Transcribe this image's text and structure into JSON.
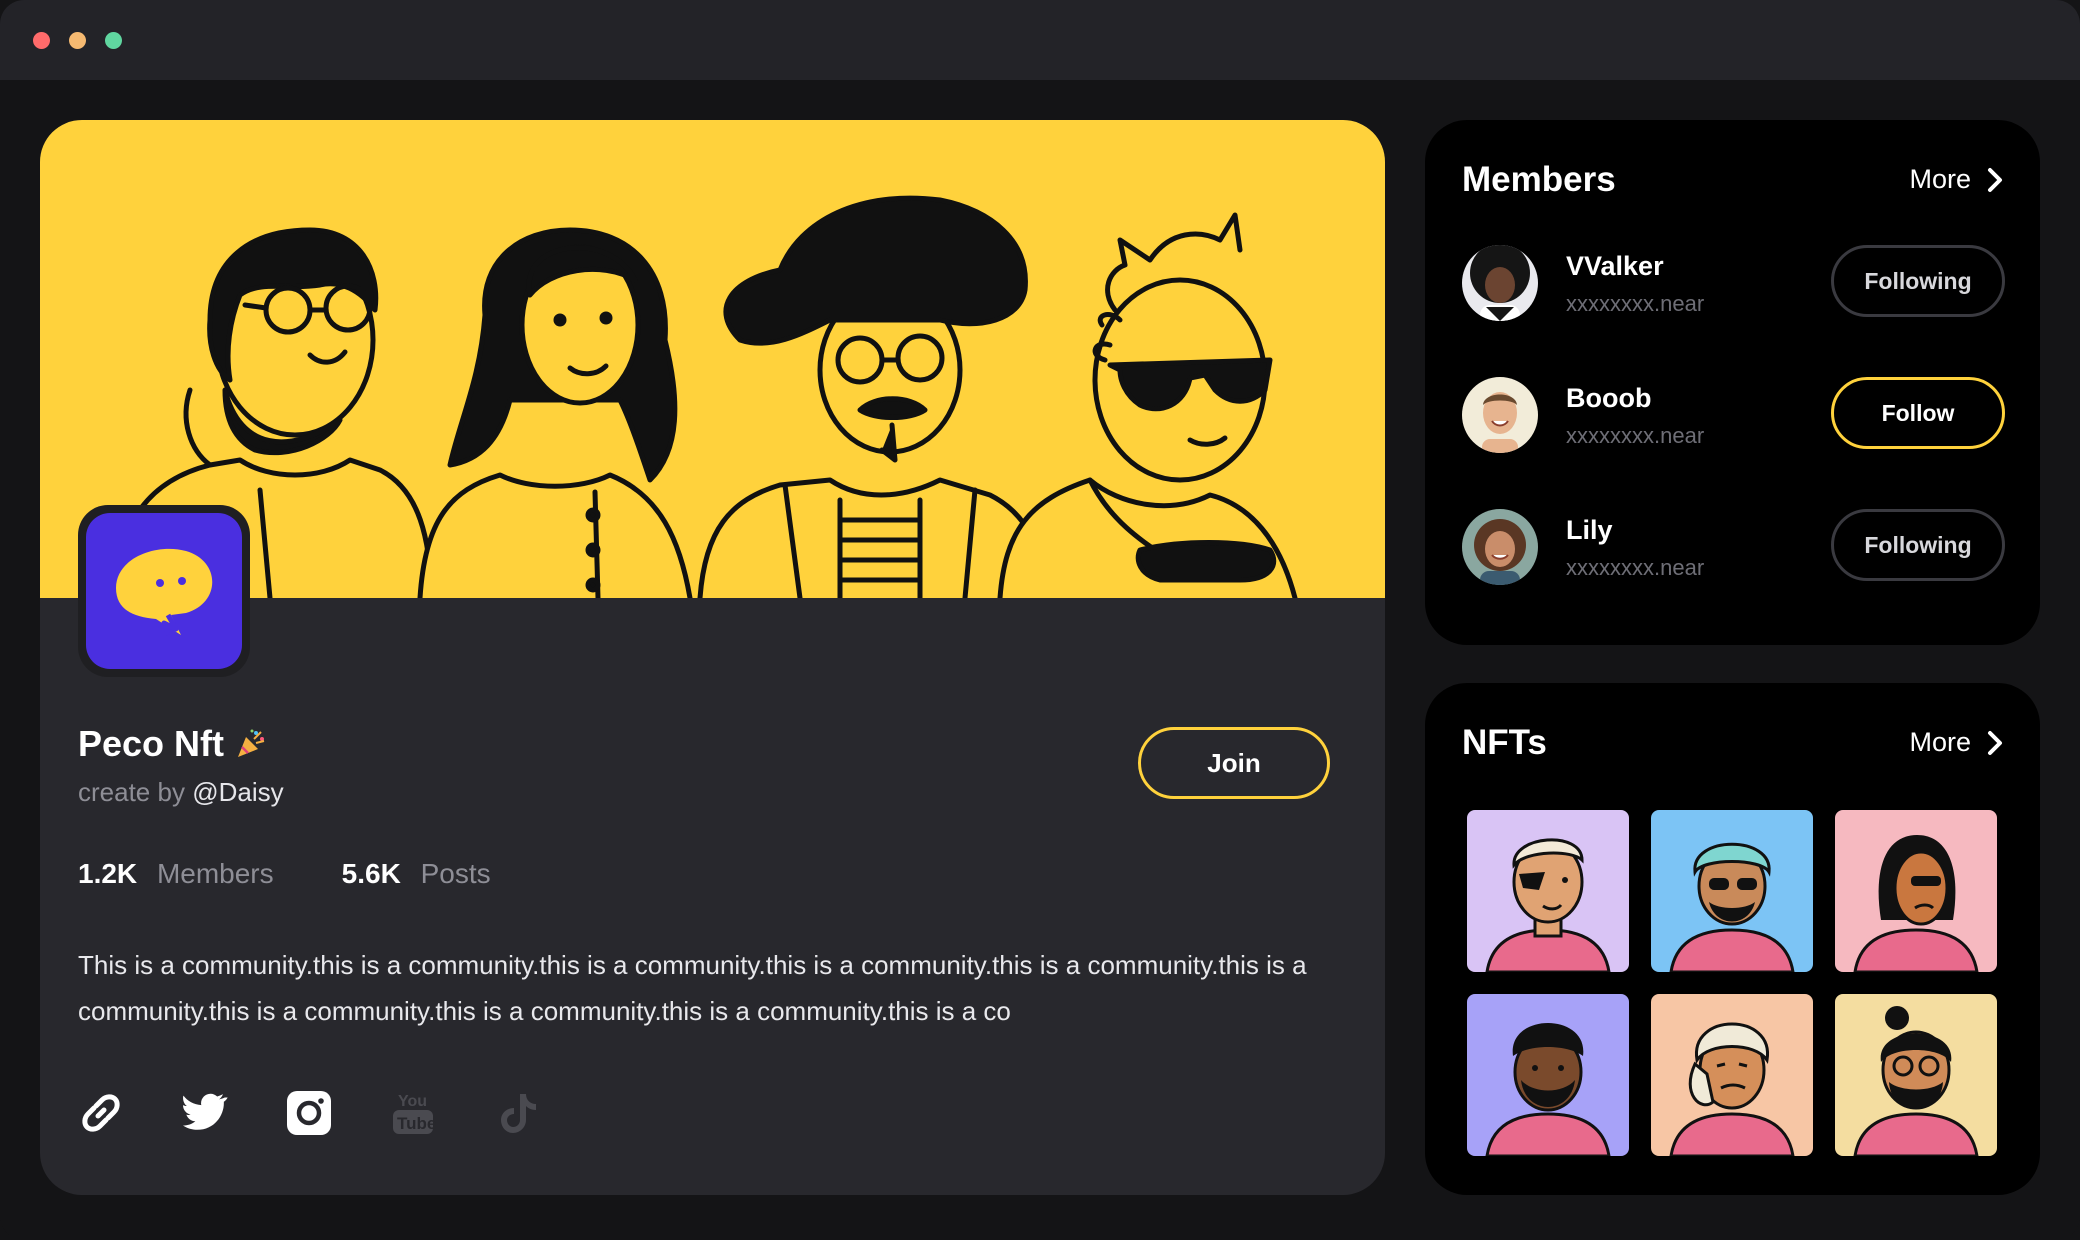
{
  "window": {
    "controls": [
      "close",
      "minimize",
      "maximize"
    ],
    "colors": {
      "close": "#ff6b6b",
      "minimize": "#f5b971",
      "maximize": "#60d6a0"
    }
  },
  "community": {
    "name": "Peco Nft",
    "emoji_icon": "party-popper-icon",
    "creator_prefix": "create by",
    "creator_handle": "@Daisy",
    "join_label": "Join",
    "stats": [
      {
        "value": "1.2K",
        "label": "Members"
      },
      {
        "value": "5.6K",
        "label": "Posts"
      }
    ],
    "description": "This is a community.this is a community.this is a community.this is a community.this is a community.this is a community.this is a community.this is a community.this is a community.this is a co",
    "socials": [
      "link-icon",
      "twitter-icon",
      "instagram-icon",
      "youtube-icon",
      "tiktok-icon"
    ],
    "accent_color": "#ffd23c",
    "logo_color": "#4a2fe0"
  },
  "members": {
    "title": "Members",
    "more_label": "More",
    "items": [
      {
        "name": "VValker",
        "sub": "xxxxxxxx.near",
        "action": "Following",
        "state": "following"
      },
      {
        "name": "Booob",
        "sub": "xxxxxxxx.near",
        "action": "Follow",
        "state": "follow"
      },
      {
        "name": "Lily",
        "sub": "xxxxxxxx.near",
        "action": "Following",
        "state": "following"
      }
    ]
  },
  "nfts": {
    "title": "NFTs",
    "more_label": "More",
    "items": [
      {
        "bg": "#d9c4f5"
      },
      {
        "bg": "#7cc4f5"
      },
      {
        "bg": "#f6b9c0"
      },
      {
        "bg": "#a7a2f8"
      },
      {
        "bg": "#f7c6a5"
      },
      {
        "bg": "#f4dda0"
      }
    ]
  }
}
